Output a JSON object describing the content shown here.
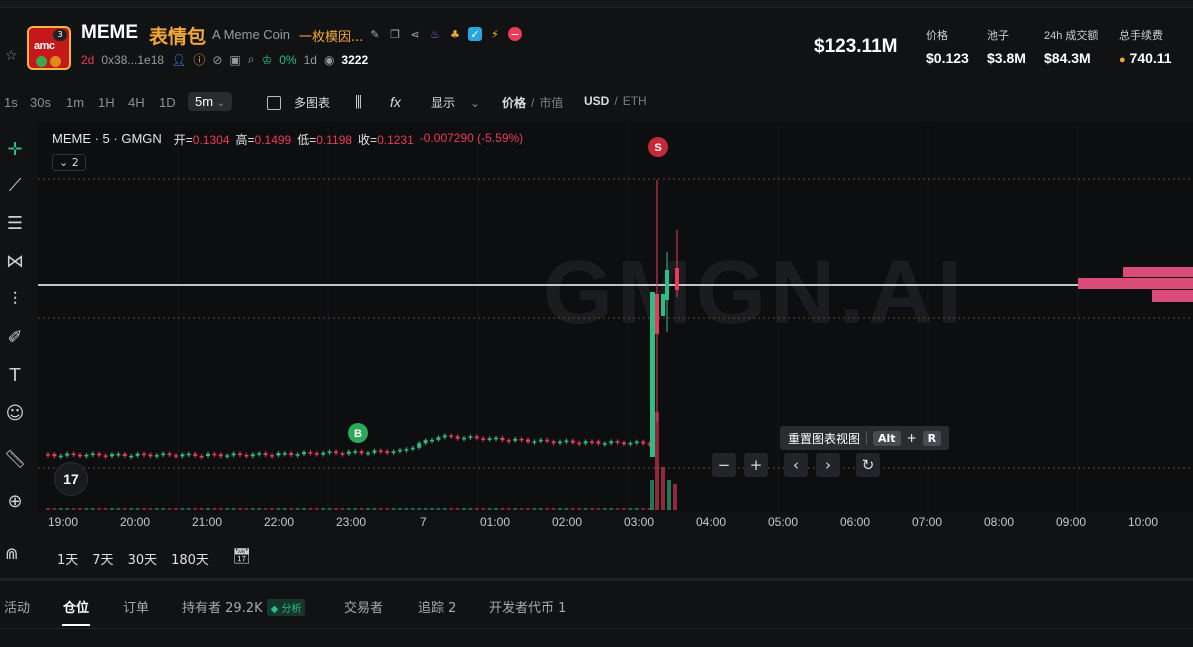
{
  "header": {
    "ticker": "MEME",
    "name_cn": "表情包",
    "subtitle": "A Meme Coin",
    "subtitle_cn": "一枚模因...",
    "logo_text": "amc",
    "logo_badge": "3",
    "age": "2d",
    "address": "0x38...1e18",
    "holders_pct": "0%",
    "holders_period": "1d",
    "views": "3222",
    "market_cap": "$123.11M",
    "stats": [
      {
        "label": "价格",
        "value": "$0.123"
      },
      {
        "label": "池子",
        "value": "$3.8M"
      },
      {
        "label": "24h 成交额",
        "value": "$84.3M"
      },
      {
        "label": "总手续费",
        "value": "740.11"
      }
    ]
  },
  "toolbar": {
    "timeframes": [
      "1s",
      "30s",
      "1m",
      "1H",
      "4H",
      "1D"
    ],
    "active_timeframe": "5m",
    "multi_chart": "多图表",
    "display": "显示",
    "price_label": "价格",
    "mcap_label": "市值",
    "usd": "USD",
    "eth": "ETH"
  },
  "chart": {
    "title": "MEME · 5 · GMGN",
    "open_label": "开=",
    "open": "0.1304",
    "high_label": "高=",
    "high": "0.1499",
    "low_label": "低=",
    "low": "0.1198",
    "close_label": "收=",
    "close": "0.1231",
    "change": "-0.007290 (-5.59%)",
    "indicators_count": "2",
    "watermark": "GMGN.AI",
    "marker_sell": "S",
    "marker_buy": "B",
    "tv_logo": "17",
    "reset_tooltip": "重置图表视图",
    "kbd_alt": "Alt",
    "kbd_plus": "+",
    "kbd_r": "R",
    "zoom_out": "−",
    "zoom_in": "+",
    "xaxis": [
      "19:00",
      "20:00",
      "21:00",
      "22:00",
      "23:00",
      "7",
      "01:00",
      "02:00",
      "03:00",
      "04:00",
      "05:00",
      "06:00",
      "07:00",
      "08:00",
      "09:00",
      "10:00"
    ]
  },
  "ranges": [
    "1天",
    "7天",
    "30天",
    "180天"
  ],
  "tabs": [
    {
      "label": "活动"
    },
    {
      "label": "仓位"
    },
    {
      "label": "订单"
    },
    {
      "label": "持有者 29.2K"
    },
    {
      "label": "交易者"
    },
    {
      "label": "追踪 2"
    },
    {
      "label": "开发者代币 1"
    }
  ],
  "analysis_badge": "分析",
  "colors": {
    "up": "#2ebd85",
    "down": "#ea3c5a",
    "accent": "#f2a93b"
  }
}
